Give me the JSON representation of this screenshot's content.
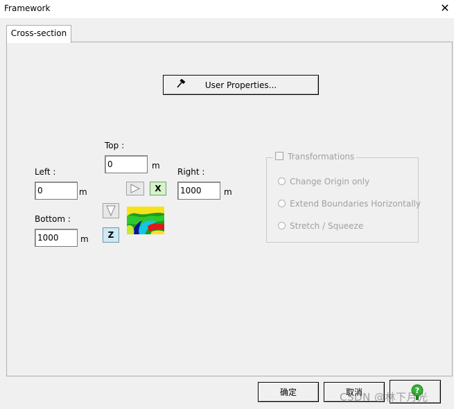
{
  "window": {
    "title": "Framework"
  },
  "tabs": [
    {
      "label": "Cross-section"
    }
  ],
  "user_properties_button": {
    "label": "User Properties..."
  },
  "fields": {
    "top": {
      "label": "Top :",
      "value": "0",
      "unit": "m"
    },
    "left": {
      "label": "Left :",
      "value": "0",
      "unit": "m"
    },
    "right": {
      "label": "Right :",
      "value": "1000",
      "unit": "m"
    },
    "bottom": {
      "label": "Bottom :",
      "value": "1000",
      "unit": "m"
    }
  },
  "axis_buttons": {
    "x": "X",
    "z": "Z"
  },
  "transformations": {
    "title": "Transformations",
    "checked": false,
    "options": [
      {
        "label": "Change Origin only"
      },
      {
        "label": "Extend Boundaries Horizontally"
      },
      {
        "label": "Stretch / Squeeze"
      }
    ]
  },
  "dialog_buttons": {
    "ok": "确定",
    "cancel": "取消"
  },
  "watermark": "CSDN @林下月光",
  "colors": {
    "accent_green": "#d7f2c8",
    "accent_blue": "#cfe9f3"
  }
}
